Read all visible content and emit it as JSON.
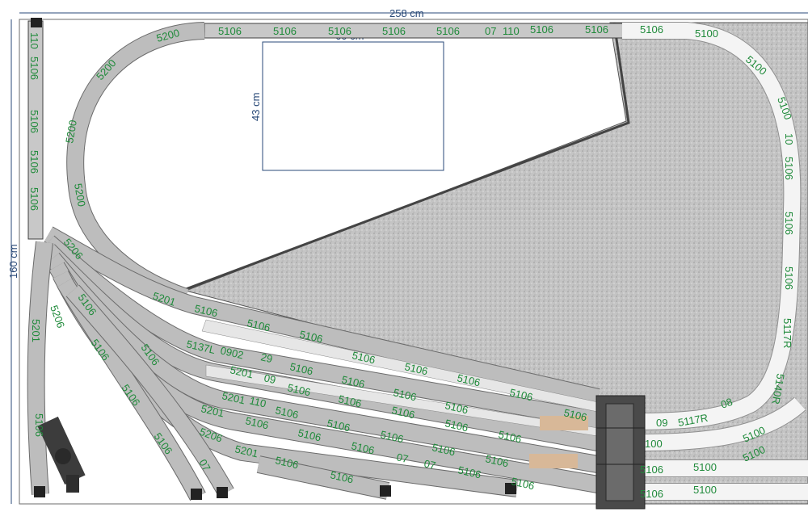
{
  "dimensions": {
    "width": "258 cm",
    "height": "160 cm",
    "box_width": "60 cm",
    "box_height": "43 cm"
  },
  "colors": {
    "track_label": "#1f8a3a",
    "dimension": "#2a4a78",
    "track_fill": "#c8c8c8",
    "baseboard": "#b9b9b9",
    "gravel": "#bdbdbd"
  },
  "labels": {
    "top_straight": [
      "5106",
      "5106",
      "5106",
      "5106",
      "5106",
      "07",
      "110",
      "5106",
      "5106"
    ],
    "top_right": [
      "5106",
      "5100",
      "5100",
      "5100",
      "10",
      "5106",
      "5106",
      "5106",
      "5117R",
      "5140R"
    ],
    "left_column": [
      "110",
      "5106",
      "5106",
      "5106",
      "5106",
      "5201",
      "5106"
    ],
    "top_curve": [
      "5200",
      "5200",
      "5200",
      "5200"
    ],
    "yard_row1": [
      "5201",
      "5106",
      "5106",
      "5106",
      "5106",
      "5106",
      "5106",
      "5106",
      "5106"
    ],
    "yard_row2": [
      "5137L",
      "0902",
      "29",
      "5106",
      "5106",
      "5106",
      "5106"
    ],
    "yard_row3": [
      "5201",
      "09",
      "5106",
      "5106",
      "5106",
      "5106",
      "5106"
    ],
    "yard_row4": [
      "5201",
      "110",
      "5106",
      "5106",
      "5106",
      "5106",
      "5106"
    ],
    "yard_row5": [
      "5201",
      "5106",
      "5106",
      "5106",
      "5106",
      "5106"
    ],
    "yard_row6": [
      "5206",
      "5201",
      "5106",
      "07",
      "07",
      "5106"
    ],
    "yard_row7": [
      "5201",
      "5106",
      "5106",
      "110"
    ],
    "bottom_right": [
      "5106",
      "5100",
      "5100",
      "5106",
      "5100",
      "5100",
      "5117R",
      "08",
      "09",
      "100"
    ],
    "diagonal_left": [
      "5206",
      "5106",
      "5106",
      "5106",
      "5106",
      "07",
      "5206",
      "5106"
    ]
  }
}
